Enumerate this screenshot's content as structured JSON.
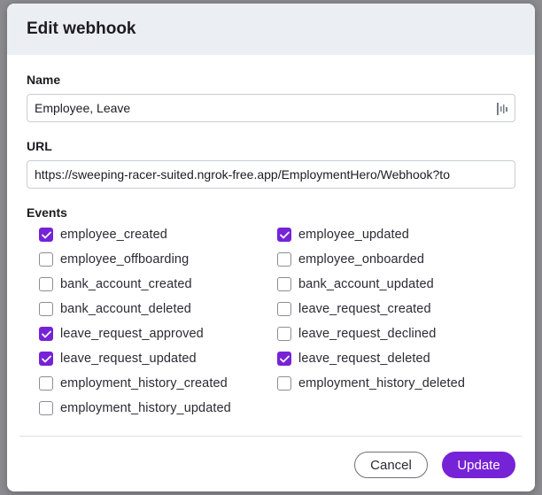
{
  "dialog": {
    "title": "Edit webhook"
  },
  "name_field": {
    "label": "Name",
    "value": "Employee, Leave",
    "icon": "barcode-icon"
  },
  "url_field": {
    "label": "URL",
    "value": "https://sweeping-racer-suited.ngrok-free.app/EmploymentHero/Webhook?to"
  },
  "events": {
    "label": "Events",
    "items": [
      {
        "label": "employee_created",
        "checked": true
      },
      {
        "label": "employee_updated",
        "checked": true
      },
      {
        "label": "employee_offboarding",
        "checked": false
      },
      {
        "label": "employee_onboarded",
        "checked": false
      },
      {
        "label": "bank_account_created",
        "checked": false
      },
      {
        "label": "bank_account_updated",
        "checked": false
      },
      {
        "label": "bank_account_deleted",
        "checked": false
      },
      {
        "label": "leave_request_created",
        "checked": false
      },
      {
        "label": "leave_request_approved",
        "checked": true
      },
      {
        "label": "leave_request_declined",
        "checked": false
      },
      {
        "label": "leave_request_updated",
        "checked": true
      },
      {
        "label": "leave_request_deleted",
        "checked": true
      },
      {
        "label": "employment_history_created",
        "checked": false
      },
      {
        "label": "employment_history_deleted",
        "checked": false
      },
      {
        "label": "employment_history_updated",
        "checked": false
      }
    ]
  },
  "footer": {
    "cancel_label": "Cancel",
    "update_label": "Update"
  },
  "colors": {
    "accent": "#7622d7",
    "header_bg": "#ebeff4"
  }
}
